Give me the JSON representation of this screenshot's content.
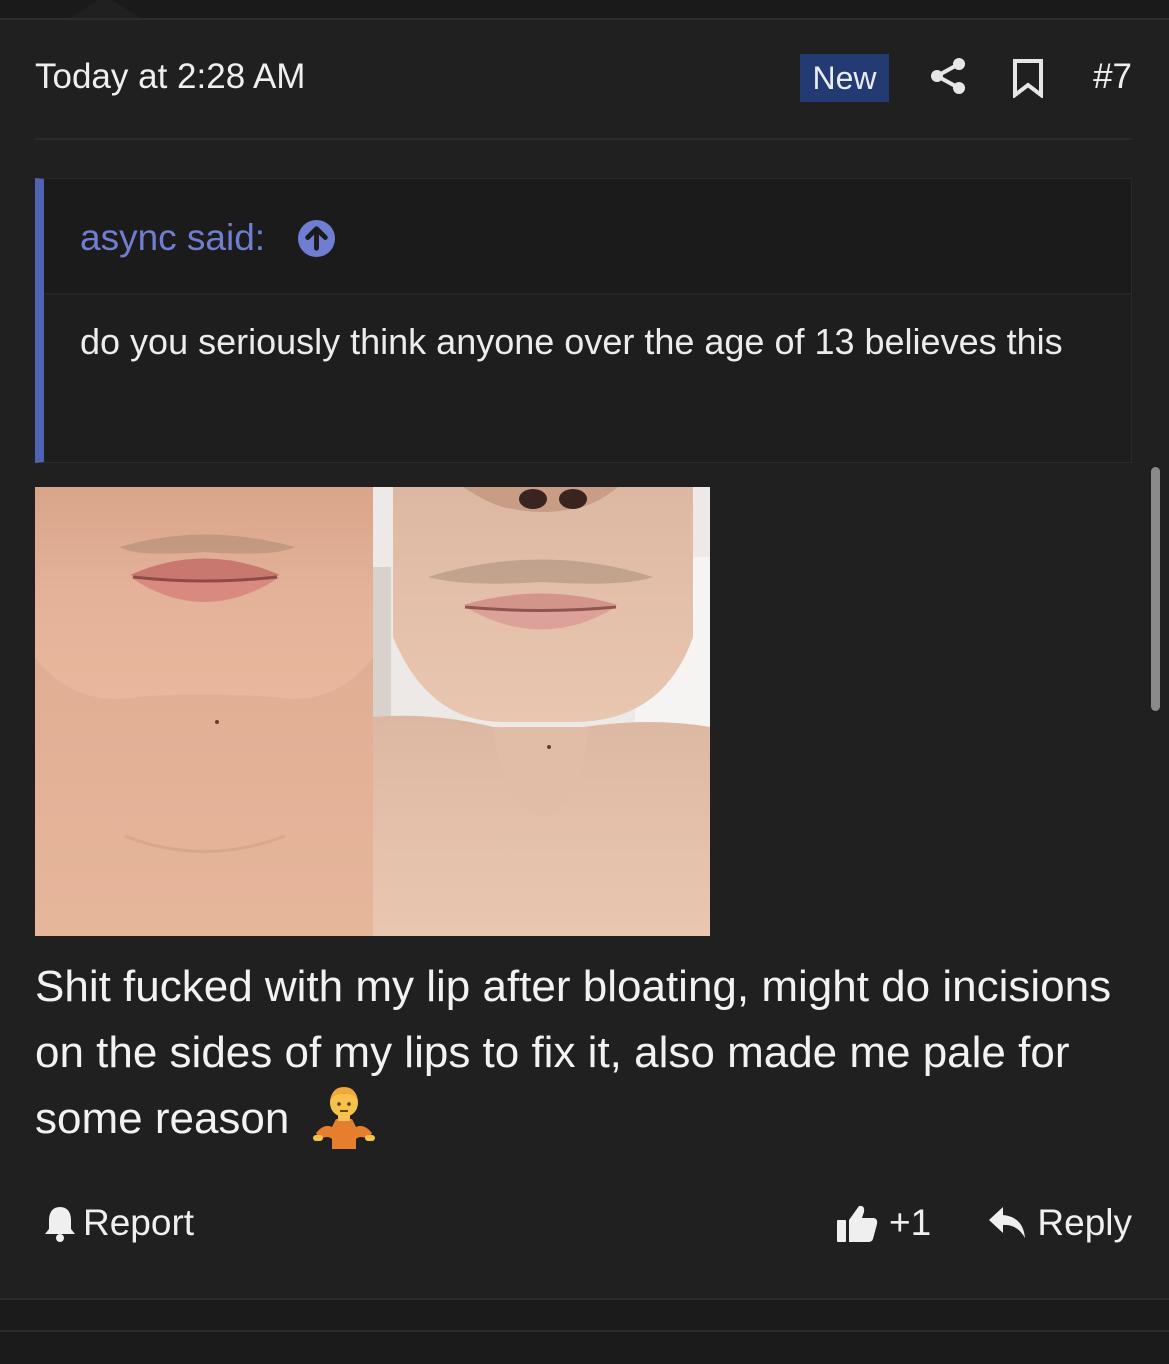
{
  "post": {
    "timestamp": "Today at 2:28 AM",
    "new_badge": "New",
    "number": "#7",
    "icons": {
      "share": "share-icon",
      "bookmark": "bookmark-icon"
    }
  },
  "quote": {
    "author": "async said:",
    "arrow_icon": "arrow-up-circle-icon",
    "text": "do you seriously think anyone over the age of 13 believes this"
  },
  "images": [
    {
      "name": "before-photo",
      "kind": "photo"
    },
    {
      "name": "after-photo",
      "kind": "photo"
    }
  ],
  "message": {
    "text": "Shit fucked with my lip after bloating, might do incisions on the sides of my lips to fix it, also made me pale for some reason",
    "emoji": "person-shrugging-emoji"
  },
  "actions": {
    "report": "Report",
    "like_count": "+1",
    "reply": "Reply"
  },
  "colors": {
    "background": "#202020",
    "accent": "#4f63b3",
    "quote_author": "#6f7ed0",
    "new_badge": "#233a73"
  }
}
